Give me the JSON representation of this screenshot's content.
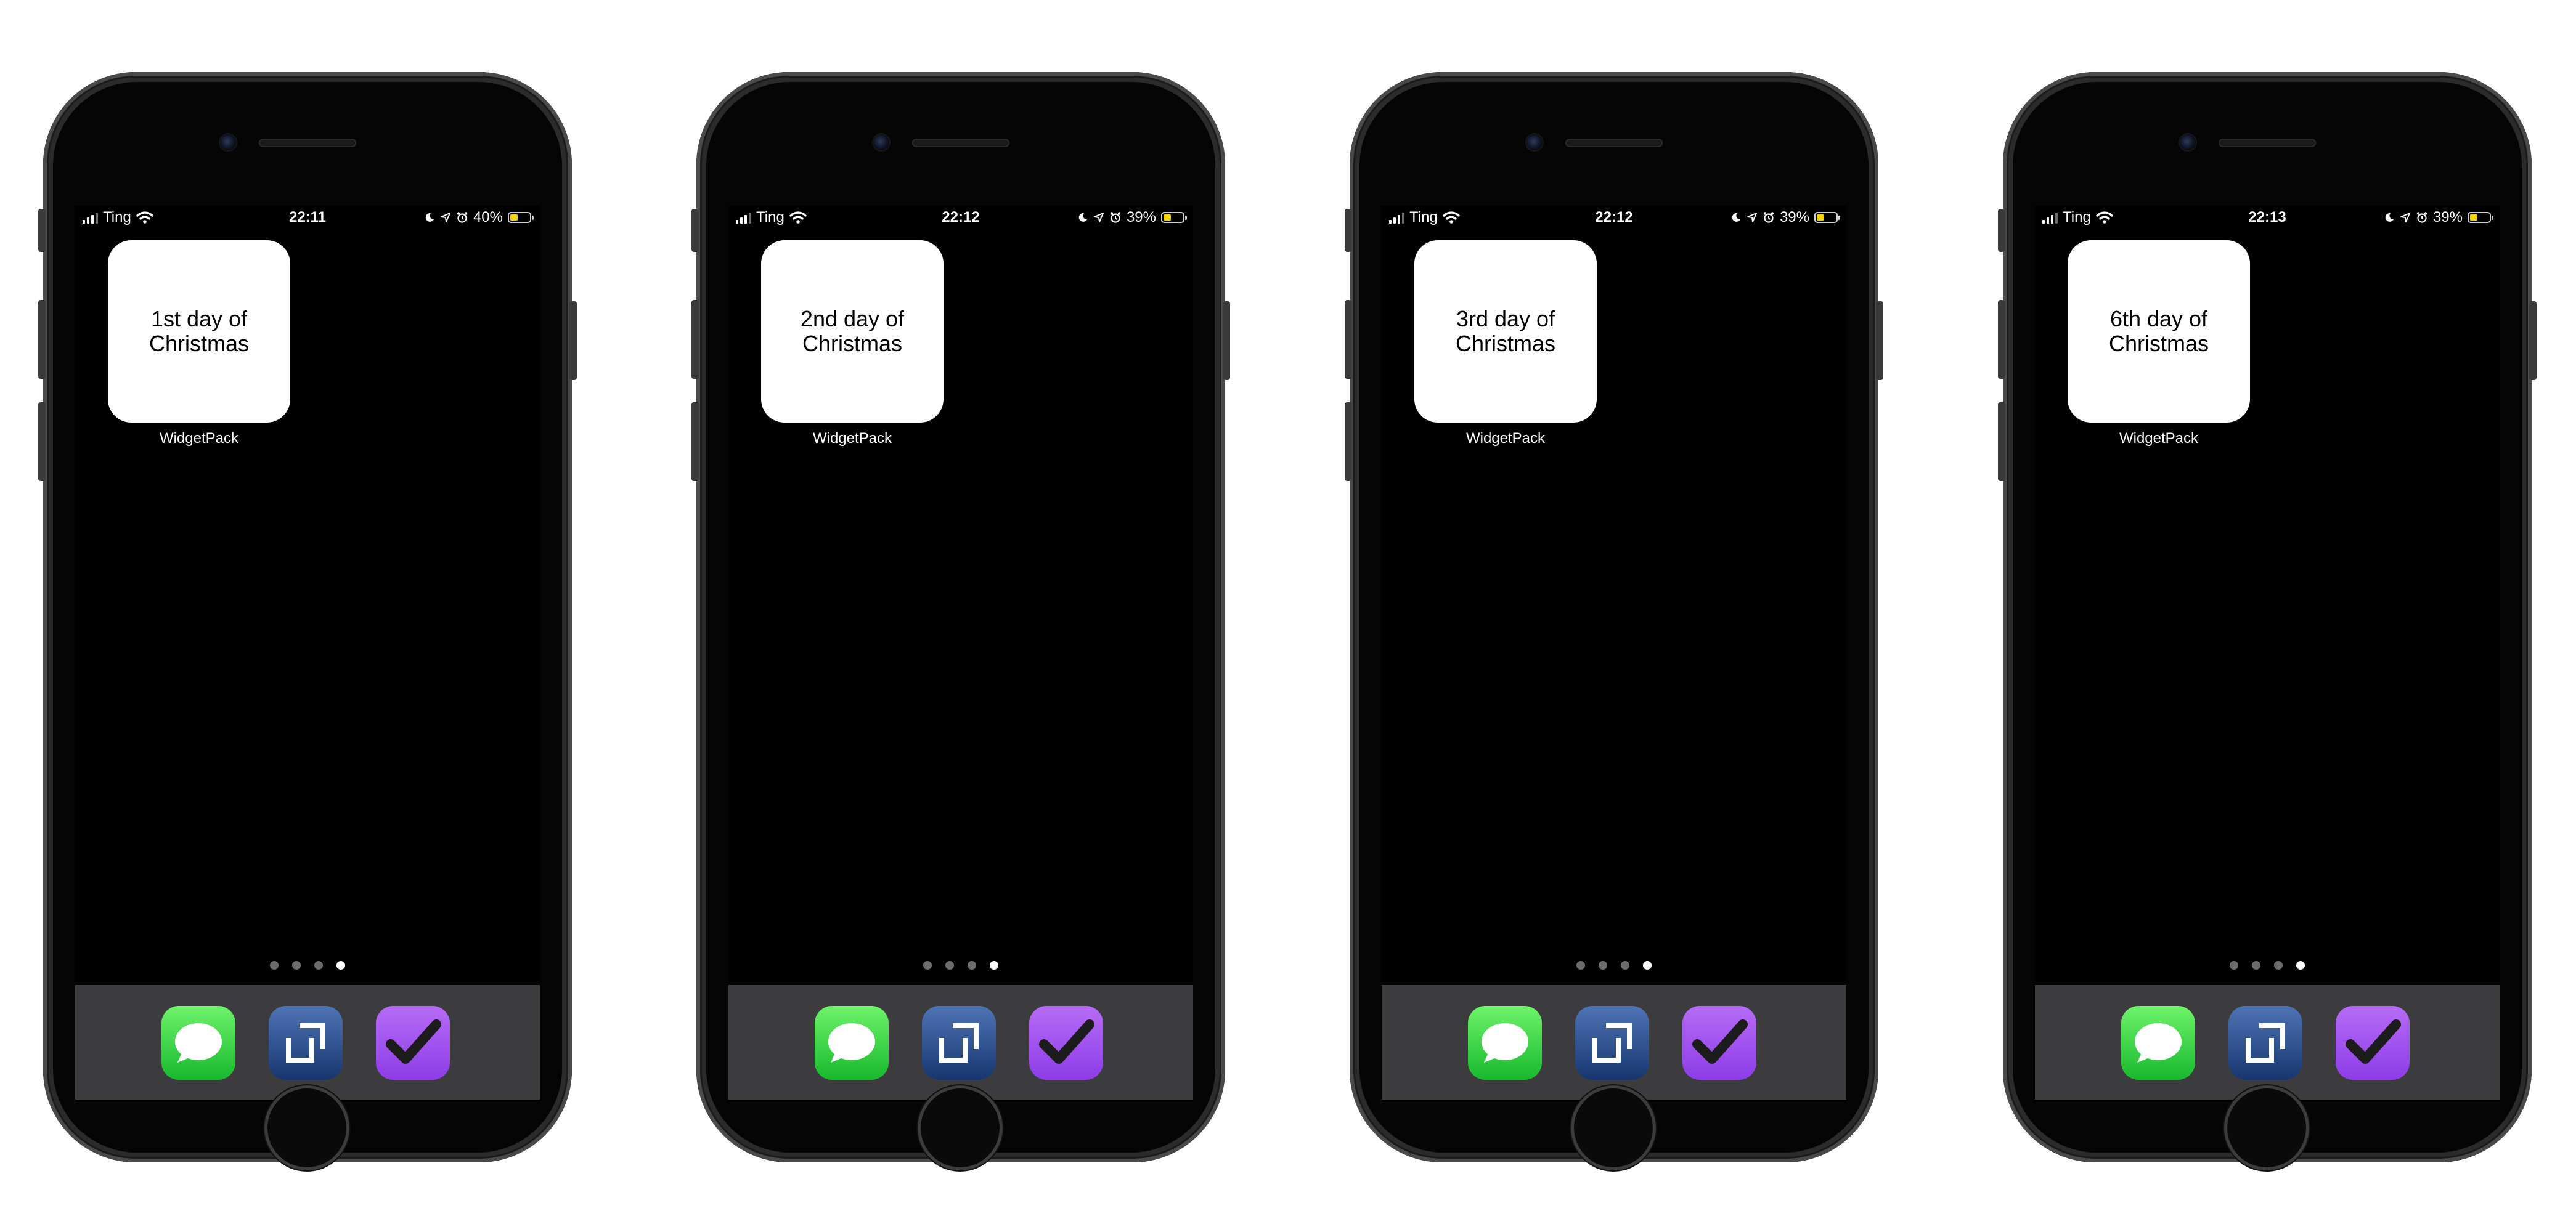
{
  "colors": {
    "background": "#ffffff",
    "phone_body": "#2b2b2d",
    "screen": "#000000",
    "dock": "#3c3c3e",
    "battery_fill": "#f5d40b",
    "messages_app": "#28c840",
    "blue_app": "#2a4d8f",
    "purple_app": "#a152f0"
  },
  "phones": [
    {
      "status": {
        "carrier": "Ting",
        "time": "22:11",
        "battery_percent": "40%",
        "battery_level": 0.4
      },
      "widget": {
        "text": "1st day of\nChristmas",
        "label": "WidgetPack"
      },
      "page_dots": {
        "count": 4,
        "active_index": 3
      },
      "dock_apps": [
        "messages-app-icon",
        "blue-square-app-icon",
        "checkmark-app-icon"
      ]
    },
    {
      "status": {
        "carrier": "Ting",
        "time": "22:12",
        "battery_percent": "39%",
        "battery_level": 0.39
      },
      "widget": {
        "text": "2nd day of\nChristmas",
        "label": "WidgetPack"
      },
      "page_dots": {
        "count": 4,
        "active_index": 3
      },
      "dock_apps": [
        "messages-app-icon",
        "blue-square-app-icon",
        "checkmark-app-icon"
      ]
    },
    {
      "status": {
        "carrier": "Ting",
        "time": "22:12",
        "battery_percent": "39%",
        "battery_level": 0.39
      },
      "widget": {
        "text": "3rd day of\nChristmas",
        "label": "WidgetPack"
      },
      "page_dots": {
        "count": 4,
        "active_index": 3
      },
      "dock_apps": [
        "messages-app-icon",
        "blue-square-app-icon",
        "checkmark-app-icon"
      ]
    },
    {
      "status": {
        "carrier": "Ting",
        "time": "22:13",
        "battery_percent": "39%",
        "battery_level": 0.39
      },
      "widget": {
        "text": "6th day of\nChristmas",
        "label": "WidgetPack"
      },
      "page_dots": {
        "count": 4,
        "active_index": 3
      },
      "dock_apps": [
        "messages-app-icon",
        "blue-square-app-icon",
        "checkmark-app-icon"
      ]
    }
  ]
}
